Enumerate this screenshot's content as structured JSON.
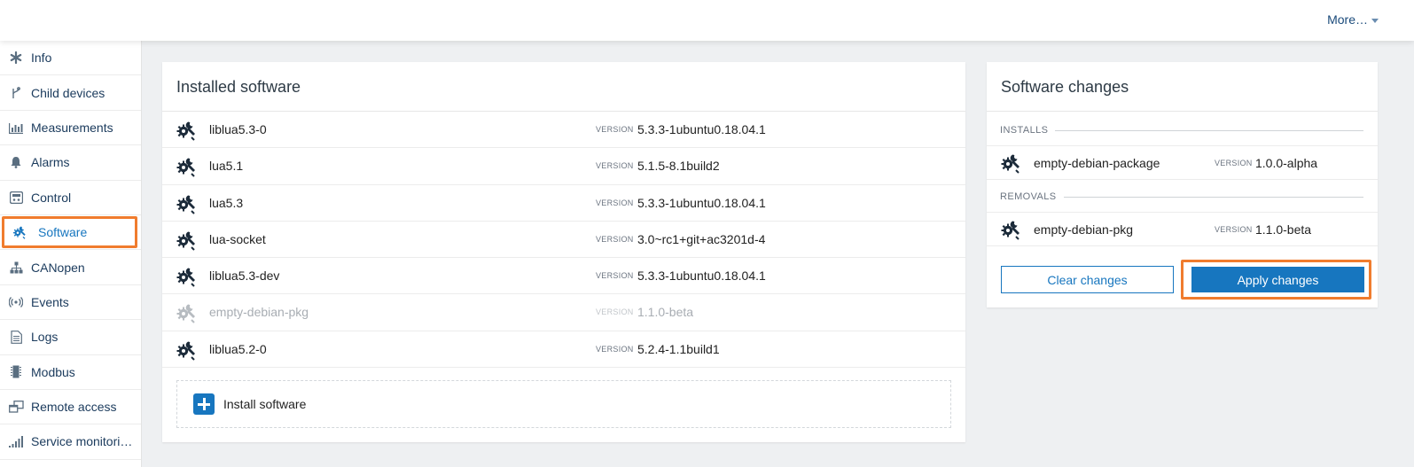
{
  "header": {
    "more_label": "More…"
  },
  "sidebar": {
    "items": [
      {
        "label": "Info",
        "icon": "asterisk-icon"
      },
      {
        "label": "Child devices",
        "icon": "branch-icon"
      },
      {
        "label": "Measurements",
        "icon": "bar-chart-icon"
      },
      {
        "label": "Alarms",
        "icon": "bell-icon"
      },
      {
        "label": "Control",
        "icon": "control-panel-icon"
      },
      {
        "label": "Software",
        "icon": "software-wrench-icon",
        "active": true
      },
      {
        "label": "CANopen",
        "icon": "network-tree-icon"
      },
      {
        "label": "Events",
        "icon": "broadcast-icon"
      },
      {
        "label": "Logs",
        "icon": "document-icon"
      },
      {
        "label": "Modbus",
        "icon": "chip-icon"
      },
      {
        "label": "Remote access",
        "icon": "remote-windows-icon"
      },
      {
        "label": "Service monitori…",
        "icon": "signal-bars-icon"
      }
    ]
  },
  "installed": {
    "title": "Installed software",
    "version_label": "VERSION",
    "items": [
      {
        "name": "liblua5.3-0",
        "version": "5.3.3-1ubuntu0.18.04.1"
      },
      {
        "name": "lua5.1",
        "version": "5.1.5-8.1build2"
      },
      {
        "name": "lua5.3",
        "version": "5.3.3-1ubuntu0.18.04.1"
      },
      {
        "name": "lua-socket",
        "version": "3.0~rc1+git+ac3201d-4"
      },
      {
        "name": "liblua5.3-dev",
        "version": "5.3.3-1ubuntu0.18.04.1"
      },
      {
        "name": "empty-debian-pkg",
        "version": "1.1.0-beta",
        "muted": true
      },
      {
        "name": "liblua5.2-0",
        "version": "5.2.4-1.1build1"
      }
    ],
    "install_label": "Install software"
  },
  "changes": {
    "title": "Software changes",
    "installs_label": "INSTALLS",
    "removals_label": "REMOVALS",
    "version_label": "VERSION",
    "install_item": {
      "name": "empty-debian-package",
      "version": "1.0.0-alpha"
    },
    "removal_item": {
      "name": "empty-debian-pkg",
      "version": "1.1.0-beta"
    },
    "clear_label": "Clear changes",
    "apply_label": "Apply changes"
  },
  "colors": {
    "accent": "#1776bf",
    "highlight": "#f07c2e",
    "nav_text": "#1a3a5c",
    "icon_dark": "#1c2b3a"
  }
}
